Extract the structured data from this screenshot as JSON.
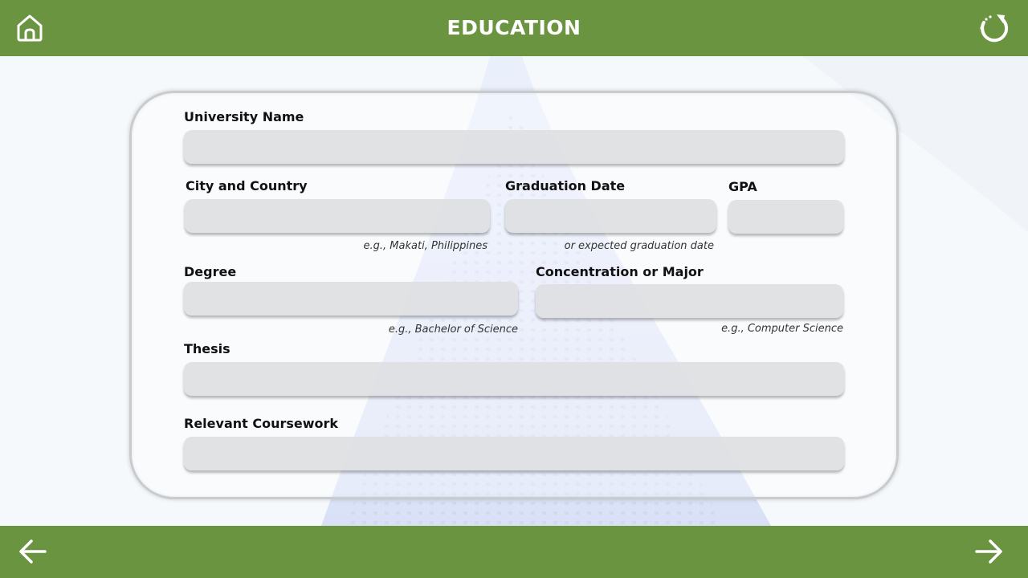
{
  "header": {
    "title": "EDUCATION",
    "home_icon": "home-icon",
    "reset_icon": "reset-icon"
  },
  "form": {
    "university_name": {
      "label": "University Name",
      "value": ""
    },
    "city_country": {
      "label": "City and Country",
      "value": "",
      "hint": "e.g., Makati, Philippines"
    },
    "graduation_date": {
      "label": "Graduation Date",
      "value": "",
      "hint": "or expected graduation date"
    },
    "gpa": {
      "label": "GPA",
      "value": ""
    },
    "degree": {
      "label": "Degree",
      "value": "",
      "hint": "e.g., Bachelor of Science"
    },
    "major": {
      "label": "Concentration or Major",
      "value": "",
      "hint": "e.g., Computer Science"
    },
    "thesis": {
      "label": "Thesis",
      "value": ""
    },
    "coursework": {
      "label": "Relevant Coursework",
      "value": ""
    }
  },
  "footer": {
    "back_icon": "arrow-left-icon",
    "next_icon": "arrow-right-icon"
  },
  "colors": {
    "bar": "#6b9441",
    "background": "#f6f9fc",
    "field": "#dedfe0"
  }
}
